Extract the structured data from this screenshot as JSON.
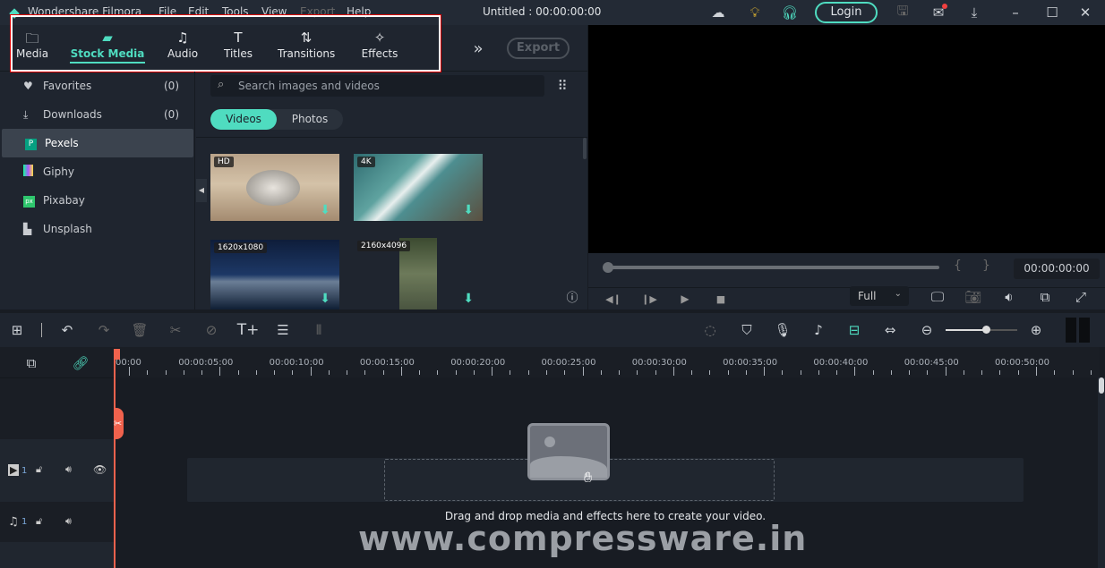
{
  "app": {
    "name": "Wondershare Filmora",
    "project_title": "Untitled : 00:00:00:00",
    "login": "Login",
    "menu": [
      "File",
      "Edit",
      "Tools",
      "View",
      "Export",
      "Help"
    ]
  },
  "tabs": [
    {
      "label": "Media",
      "icon": "folder-icon"
    },
    {
      "label": "Stock Media",
      "icon": "stock-folder-icon",
      "active": true
    },
    {
      "label": "Audio",
      "icon": "music-note-icon"
    },
    {
      "label": "Titles",
      "icon": "text-t-icon"
    },
    {
      "label": "Transitions",
      "icon": "transition-icon"
    },
    {
      "label": "Effects",
      "icon": "effects-star-icon"
    }
  ],
  "export_label": "Export",
  "sidebar": [
    {
      "label": "Favorites",
      "count": "(0)",
      "icon": "heart-icon"
    },
    {
      "label": "Downloads",
      "count": "(0)",
      "icon": "download-icon"
    },
    {
      "label": "Pexels",
      "icon": "pexels-icon",
      "selected": true
    },
    {
      "label": "Giphy",
      "icon": "giphy-icon"
    },
    {
      "label": "Pixabay",
      "icon": "pixabay-icon"
    },
    {
      "label": "Unsplash",
      "icon": "unsplash-icon"
    }
  ],
  "search": {
    "placeholder": "Search images and videos"
  },
  "filter": {
    "videos": "Videos",
    "photos": "Photos"
  },
  "thumbs": [
    {
      "badge": "HD"
    },
    {
      "badge": "4K"
    },
    {
      "badge": "1620x1080"
    },
    {
      "badge": "2160x4096"
    }
  ],
  "player": {
    "timecode": "00:00:00:00",
    "quality": "Full",
    "progress": 0
  },
  "ruler": [
    "00:00",
    "00:00:05:00",
    "00:00:10:00",
    "00:00:15:00",
    "00:00:20:00",
    "00:00:25:00",
    "00:00:30:00",
    "00:00:35:00",
    "00:00:40:00",
    "00:00:45:00",
    "00:00:50:00"
  ],
  "tracks": {
    "video": "1",
    "audio": "1"
  },
  "drop_hint": "Drag and drop media and effects here to create your video.",
  "watermark": "www.compressware.in",
  "colors": {
    "accent": "#4fdcc0",
    "playhead": "#f0624d"
  }
}
